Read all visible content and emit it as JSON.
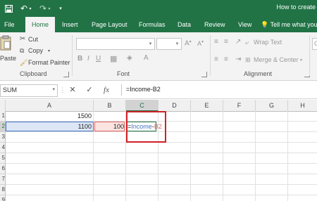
{
  "window": {
    "title": "How to create"
  },
  "quick_access": [
    "save-icon",
    "undo-icon",
    "redo-icon",
    "customize-icon"
  ],
  "tabs": [
    "File",
    "Home",
    "Insert",
    "Page Layout",
    "Formulas",
    "Data",
    "Review",
    "View"
  ],
  "active_tab": "Home",
  "tell_me": "Tell me what you",
  "ribbon": {
    "clipboard": {
      "paste": "Paste",
      "cut": "Cut",
      "copy": "Copy",
      "format_painter": "Format Painter",
      "label": "Clipboard"
    },
    "font": {
      "label": "Font",
      "name": "",
      "size": ""
    },
    "alignment": {
      "wrap_text": "Wrap Text",
      "merge_center": "Merge & Center",
      "label": "Alignment",
      "number_format": "Ge"
    }
  },
  "formula_bar": {
    "name_box": "SUM",
    "formula": "=Income-B2"
  },
  "grid": {
    "columns": [
      "A",
      "B",
      "C",
      "D",
      "E",
      "F",
      "G",
      "H"
    ],
    "selected_column": "C",
    "rows": [
      "1",
      "2",
      "3",
      "4",
      "5",
      "6",
      "7",
      "8",
      "9"
    ],
    "selected_row": "2",
    "cells": {
      "A1": "1500",
      "A2": "1100",
      "B2": "100",
      "C2": {
        "prefix": "=",
        "ref1": "Income",
        "op": "-",
        "ref2": "B2"
      }
    },
    "ref_colors": {
      "income": "#4472c4",
      "b2": "#e06666",
      "highlight": "#d12026",
      "accent": "#217346"
    }
  }
}
